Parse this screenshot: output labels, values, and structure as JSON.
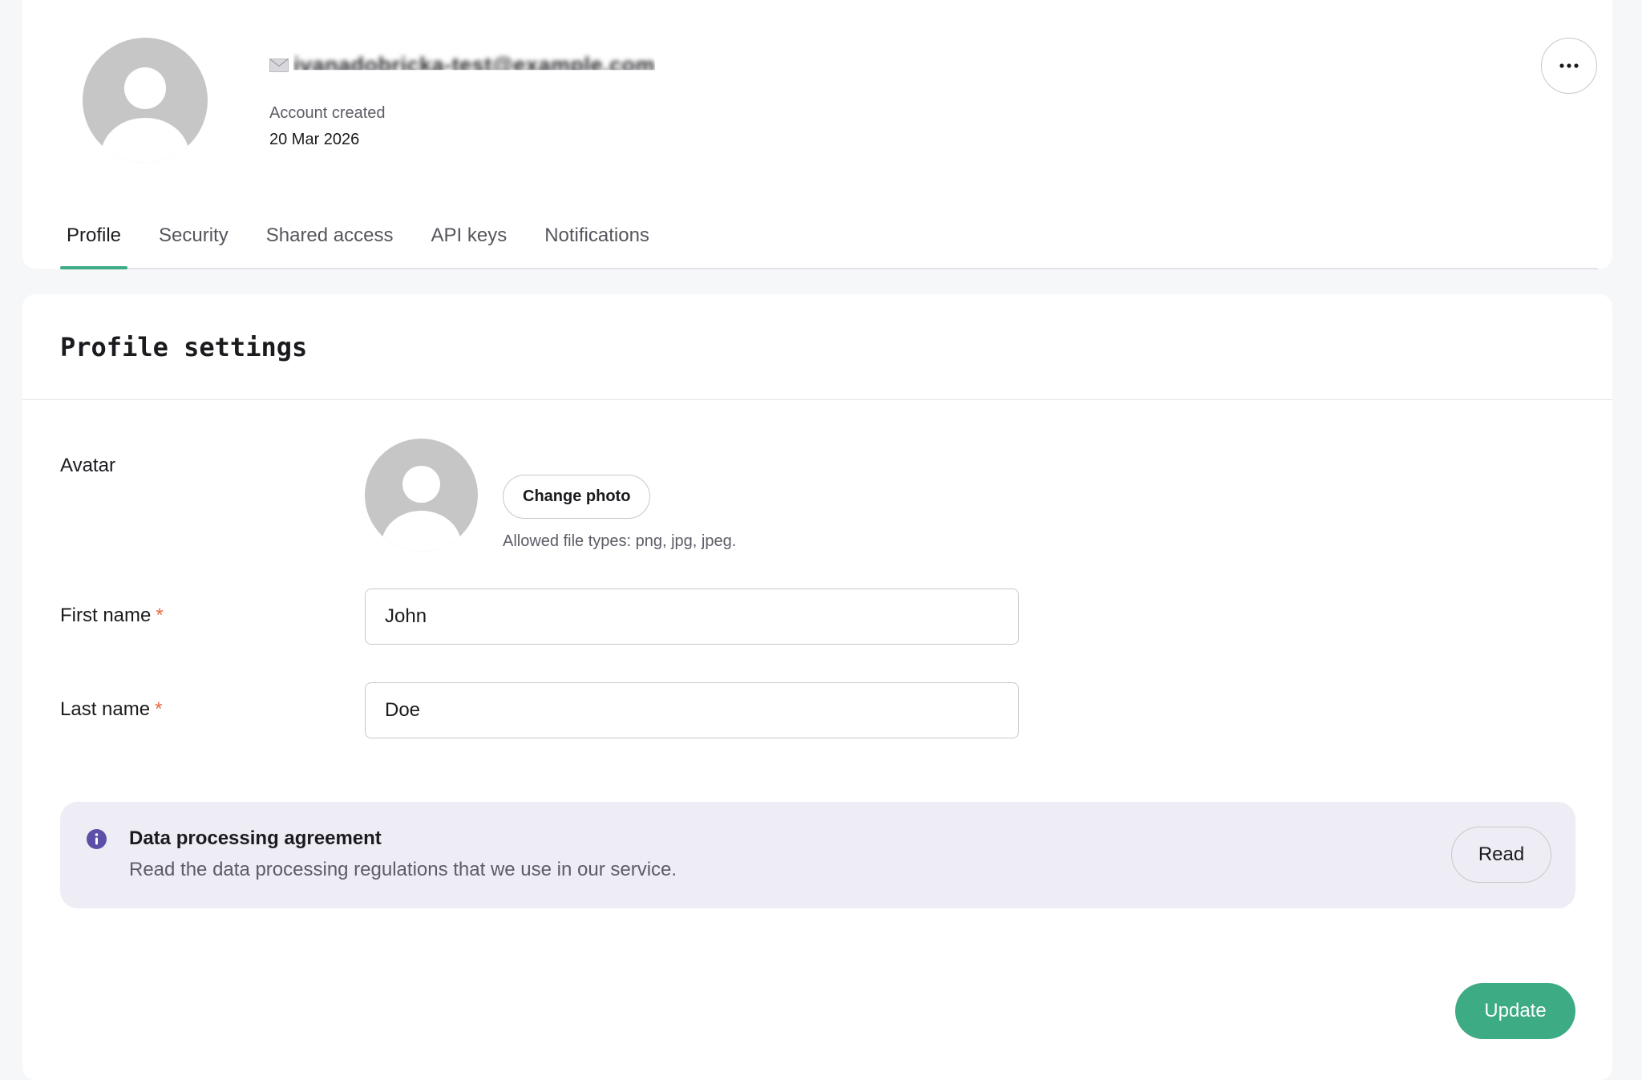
{
  "header": {
    "email": "ivanadobricka-test@example.com",
    "account_created_label": "Account created",
    "account_created_value": "20 Mar 2026"
  },
  "tabs": [
    {
      "label": "Profile",
      "active": true
    },
    {
      "label": "Security",
      "active": false
    },
    {
      "label": "Shared access",
      "active": false
    },
    {
      "label": "API keys",
      "active": false
    },
    {
      "label": "Notifications",
      "active": false
    }
  ],
  "settings": {
    "title": "Profile settings",
    "avatar_label": "Avatar",
    "change_photo_label": "Change photo",
    "allowed_types_hint": "Allowed file types: png, jpg, jpeg.",
    "first_name_label": "First name",
    "first_name_value": "John",
    "last_name_label": "Last name",
    "last_name_value": "Doe",
    "required_marker": "*"
  },
  "notice": {
    "title": "Data processing agreement",
    "text": "Read the data processing regulations that we use in our service.",
    "read_label": "Read"
  },
  "actions": {
    "update_label": "Update"
  },
  "colors": {
    "accent": "#3dab84",
    "required": "#e8693f",
    "info_icon": "#5b4fa8",
    "notice_bg": "#eeedf5"
  },
  "icons": {
    "more": "more-horizontal-icon",
    "mail": "mail-icon",
    "info": "info-icon",
    "avatar_placeholder": "user-placeholder-icon"
  }
}
